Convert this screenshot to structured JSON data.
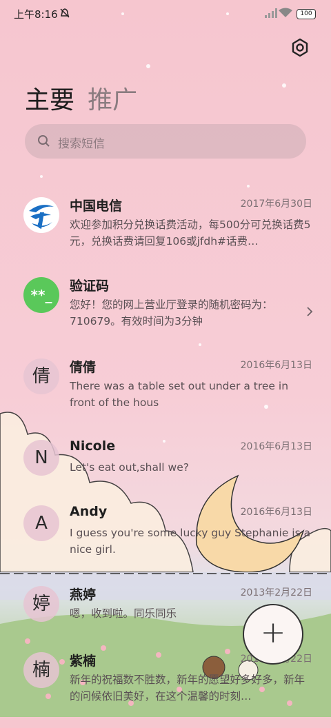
{
  "status_bar": {
    "time": "上午8:16",
    "battery": "100"
  },
  "tabs": [
    {
      "label": "主要",
      "active": true
    },
    {
      "label": "推广",
      "active": false
    }
  ],
  "search": {
    "placeholder": "搜索短信"
  },
  "conversations": [
    {
      "avatar": "",
      "avatar_type": "telecom-logo",
      "name": "中国电信",
      "date": "2017年6月30日",
      "preview": "欢迎参加积分兑换话费活动，每500分可兑换话费5元，兑换话费请回复106或jfdh#话费…"
    },
    {
      "avatar": "**_",
      "avatar_type": "verification-code",
      "name": "验证码",
      "date": "",
      "preview": "您好！您的网上营业厅登录的随机密码为：710679。有效时间为3分钟"
    },
    {
      "avatar": "倩",
      "name": "倩倩",
      "date": "2016年6月13日",
      "preview": "There was a table set out under a tree in front of the hous"
    },
    {
      "avatar": "N",
      "name": "Nicole",
      "date": "2016年6月13日",
      "preview": "Let's eat out,shall we?"
    },
    {
      "avatar": "A",
      "name": "Andy",
      "date": "2016年6月13日",
      "preview": "I guess you're some lucky guy Stephanie is a nice girl."
    },
    {
      "avatar": "婷",
      "name": "燕婷",
      "date": "2013年2月22日",
      "preview": "嗯，收到啦。同乐同乐"
    },
    {
      "avatar": "楠",
      "name": "紫楠",
      "date": "2013年2月22日",
      "preview": "新年的祝福数不胜数，新年的愿望好多好多，新年的问候依旧美好，在这个温馨的时刻…"
    }
  ],
  "colors": {
    "accent_green": "#5ac85a",
    "telecom_blue": "#1a6fc4"
  }
}
